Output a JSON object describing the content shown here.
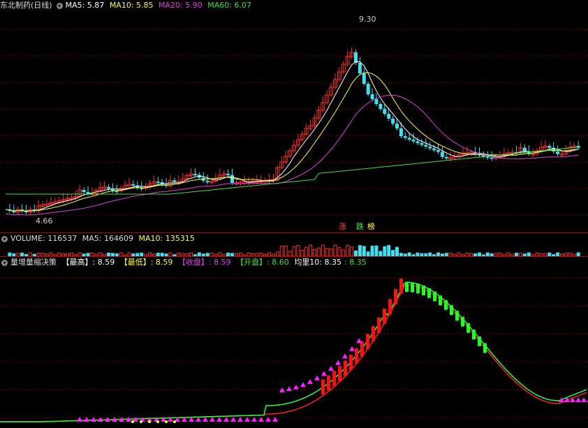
{
  "main": {
    "title": "东北制药(日线)",
    "ma5": "MA5: 5.87",
    "ma10": "MA10: 5.85",
    "ma20": "MA20: 5.90",
    "ma60": "MA60: 6.07",
    "high_label": "9.30",
    "low_label": "4.66",
    "tags": [
      "涨",
      "跌",
      "榜"
    ]
  },
  "volume": {
    "label": "VOLUME: 116537",
    "ma5": "MA5: 164609",
    "ma10": "MA10: 135315"
  },
  "indicator": {
    "title": "量增量缩决策",
    "high": "【最高】: 8.59",
    "low": "【最低】: 8.59",
    "close": "【收盘】: 8.59",
    "open": "【开盘】: 8.60",
    "avg": "均里10: 8.35",
    "avg_val": ": 8.35"
  },
  "colors": {
    "up": "#ff3030",
    "down": "#40e0f0",
    "ma5": "#ffffff",
    "ma10": "#ffff40",
    "ma20": "#e040e0",
    "ma60": "#40e040",
    "grid": "#8b0000"
  }
}
